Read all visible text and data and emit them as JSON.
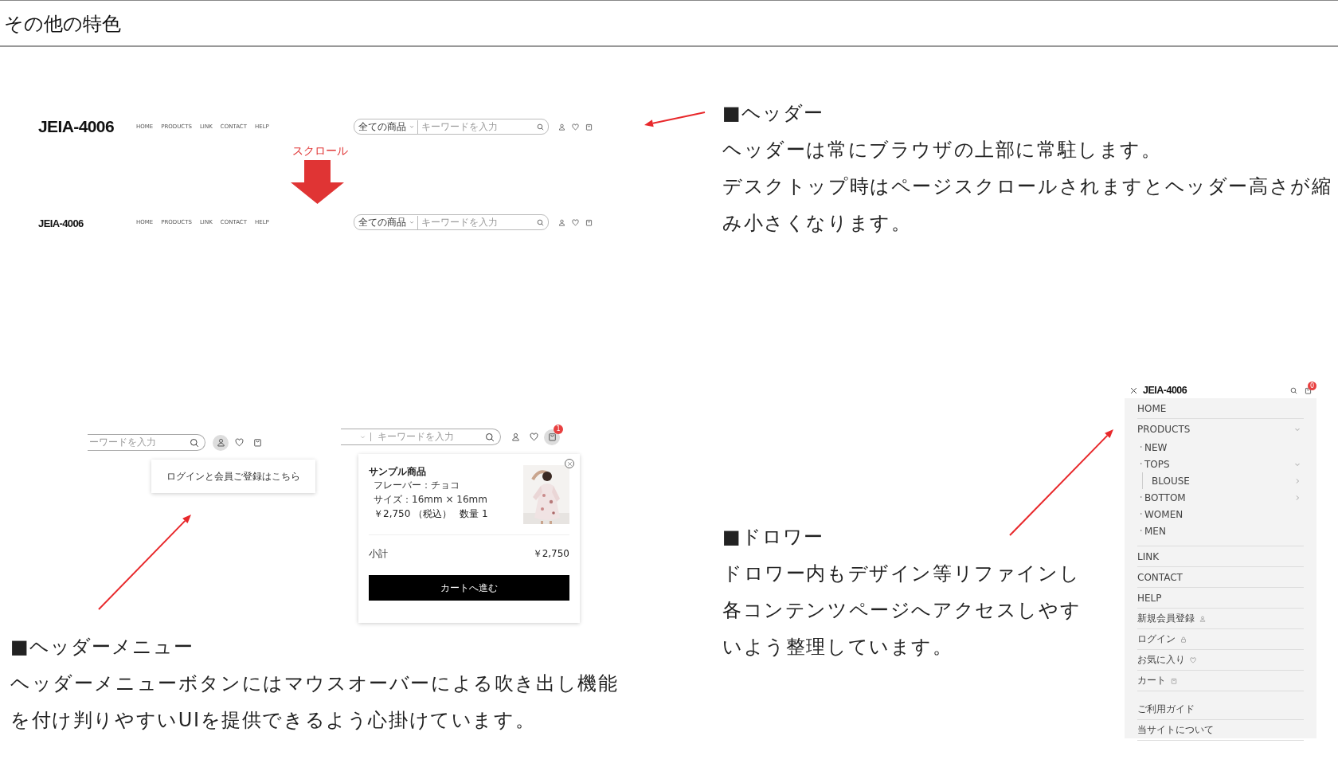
{
  "page_title": "その他の特色",
  "header_demo": {
    "headers": [
      {
        "kind": "large",
        "logo": "JEIA-4006",
        "nav": [
          "HOME",
          "PRODUCTS",
          "LINK",
          "CONTACT",
          "HELP"
        ],
        "category": "全ての商品",
        "placeholder": "キーワードを入力"
      },
      {
        "kind": "small",
        "logo": "JEIA-4006",
        "nav": [
          "HOME",
          "PRODUCTS",
          "LINK",
          "CONTACT",
          "HELP"
        ],
        "category": "全ての商品",
        "placeholder": "キーワードを入力"
      }
    ],
    "scroll_label": "スクロール"
  },
  "header_note": {
    "heading": "■ヘッダー",
    "paragraphs": [
      "ヘッダーは常にブラウザの上部に常駐します。",
      "デスクトップ時はページスクロールされますとヘッダー高さが縮み小さくなります。"
    ]
  },
  "menu_demos": [
    {
      "kind": "tooltip",
      "placeholder": "ーワードを入力",
      "icons": [
        {
          "kind": "user",
          "highlighted": true
        },
        {
          "kind": "heart",
          "highlighted": false
        },
        {
          "kind": "cart",
          "highlighted": false
        }
      ],
      "tooltip": "ログインと会員ご登録はこちら"
    },
    {
      "kind": "cart",
      "placeholder": "キーワードを入力",
      "icons": [
        {
          "kind": "user",
          "highlighted": false
        },
        {
          "kind": "heart",
          "highlighted": false
        },
        {
          "kind": "cart",
          "highlighted": true,
          "badge": "1"
        }
      ],
      "cart": {
        "product": "サンプル商品",
        "options": [
          "フレーバー：チョコ",
          "サイズ：16mm × 16mm"
        ],
        "price": "￥2,750 （税込）",
        "quantity": "数量 1",
        "subtotal_label": "小計",
        "subtotal": "￥2,750",
        "checkout": "カートへ進む"
      }
    }
  ],
  "menu_note": {
    "heading": "■ヘッダーメニュー",
    "paragraphs": [
      "ヘッダーメニューボタンにはマウスオーバーによる吹き出し機能を付け判りやすいUIを提供できるよう心掛けています。"
    ]
  },
  "drawer_note": {
    "heading": "■ドロワー",
    "paragraphs": [
      "ドロワー内もデザイン等リファインし各コンテンツページへアクセスしやすいよう整理しています。"
    ]
  },
  "drawer": {
    "logo": "JEIA-4006",
    "cart_badge": "0",
    "menu": [
      {
        "label": "HOME"
      },
      {
        "label": "PRODUCTS",
        "expanded": true,
        "children": [
          {
            "label": "NEW"
          },
          {
            "label": "TOPS",
            "expanded": true,
            "children": [
              {
                "label": "BLOUSE",
                "expanded": false
              }
            ]
          },
          {
            "label": "BOTTOM",
            "expanded": false
          },
          {
            "label": "WOMEN"
          },
          {
            "label": "MEN"
          }
        ]
      },
      {
        "label": "LINK"
      },
      {
        "label": "CONTACT"
      },
      {
        "label": "HELP"
      }
    ],
    "account": [
      {
        "label": "新規会員登録",
        "kind": "user"
      },
      {
        "label": "ログイン",
        "kind": "lock"
      },
      {
        "label": "お気に入り",
        "kind": "heart"
      },
      {
        "label": "カート",
        "kind": "cart"
      }
    ],
    "info": [
      "ご利用ガイド",
      "当サイトについて"
    ]
  }
}
